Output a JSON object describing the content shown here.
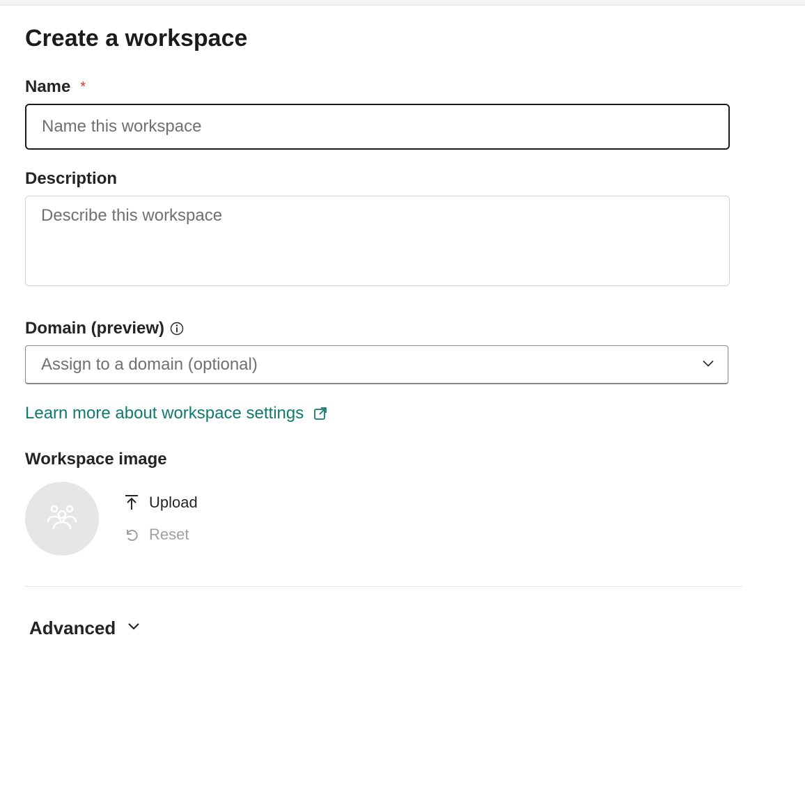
{
  "pageTitle": "Create a workspace",
  "name": {
    "label": "Name",
    "required": true,
    "placeholder": "Name this workspace",
    "value": ""
  },
  "description": {
    "label": "Description",
    "placeholder": "Describe this workspace",
    "value": ""
  },
  "domain": {
    "label": "Domain (preview)",
    "placeholder": "Assign to a domain (optional)",
    "value": ""
  },
  "learnMore": {
    "text": "Learn more about workspace settings"
  },
  "workspaceImage": {
    "label": "Workspace image",
    "uploadLabel": "Upload",
    "resetLabel": "Reset"
  },
  "advanced": {
    "label": "Advanced"
  },
  "requiredMarker": "*"
}
